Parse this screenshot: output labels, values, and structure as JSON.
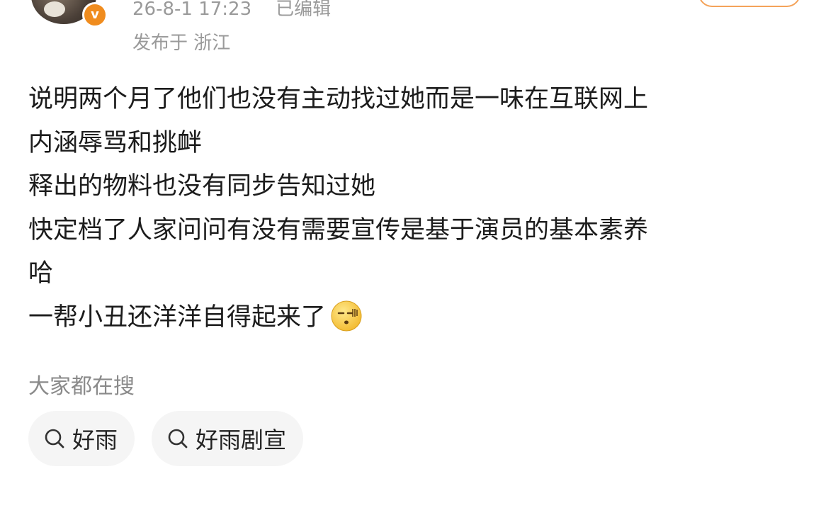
{
  "header": {
    "time": "26-8-1 17:23",
    "edited": "已编辑",
    "location": "发布于 浙江",
    "badge_icon": "verified-v-badge",
    "badge_color": "#f08c1e"
  },
  "post": {
    "lines": [
      "说明两个月了他们也没有主动找过她而是一味在互联网上",
      "内涵辱骂和挑衅",
      "释出的物料也没有同步告知过她",
      "快定档了人家问问有没有需要宣传是基于演员的基本素养",
      "哈",
      "一帮小丑还洋洋自得起来了"
    ],
    "emoji": "speechless-face-emoji"
  },
  "search": {
    "title": "大家都在搜",
    "chips": [
      {
        "label": "好雨",
        "icon": "search-icon"
      },
      {
        "label": "好雨剧宣",
        "icon": "search-icon"
      }
    ]
  }
}
